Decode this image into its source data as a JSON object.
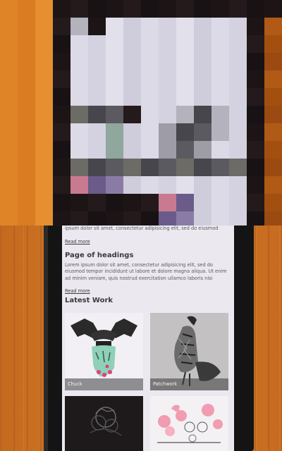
{
  "page": {
    "paragraph_top": "ipsum dolor sit amet, consectetur adipisicing elit, sed do eiusmod",
    "read_more_1": "Read more",
    "section_heading": "Page of headings",
    "paragraph_2": "Lorem ipsum dolor sit amet, consectetur adipisicing elit, sed do eiusmod tempor incididunt ut labore et dolore magna aliqua. Ut enim ad minim veniam, quis nostrud exercitation ullamco laboris nisi",
    "read_more_2": "Read more",
    "latest_heading": "Latest Work"
  },
  "works": [
    {
      "caption": "Chuck",
      "icon": "hands-illustration"
    },
    {
      "caption": "Patchwork",
      "icon": "bird-illustration"
    },
    {
      "caption": "",
      "icon": "dark-pattern-illustration"
    },
    {
      "caption": "",
      "icon": "pink-flowers-illustration"
    }
  ],
  "colors": {
    "wood": "#d27a28",
    "screen": "#ebe8f0",
    "phone_bezel": "#141414"
  }
}
